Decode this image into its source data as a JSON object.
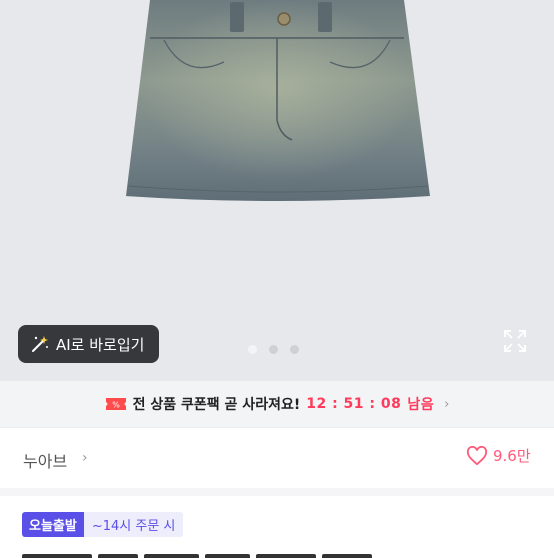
{
  "hero": {
    "ai_button_label": "AI로 바로입기",
    "image_count": 3,
    "active_image": 1
  },
  "coupon": {
    "message": "전 상품 쿠폰팩 곧 사라져요!",
    "timer": "12 : 51 : 08",
    "suffix": "남음"
  },
  "shop": {
    "name": "누아브",
    "likes": "9.6만"
  },
  "tags": {
    "today_ship": "오늘출발",
    "cutoff": "~14시 주문 시"
  },
  "colors": {
    "accent": "#ff3b5c",
    "like": "#ff5a79",
    "badge": "#5a4fe6"
  }
}
